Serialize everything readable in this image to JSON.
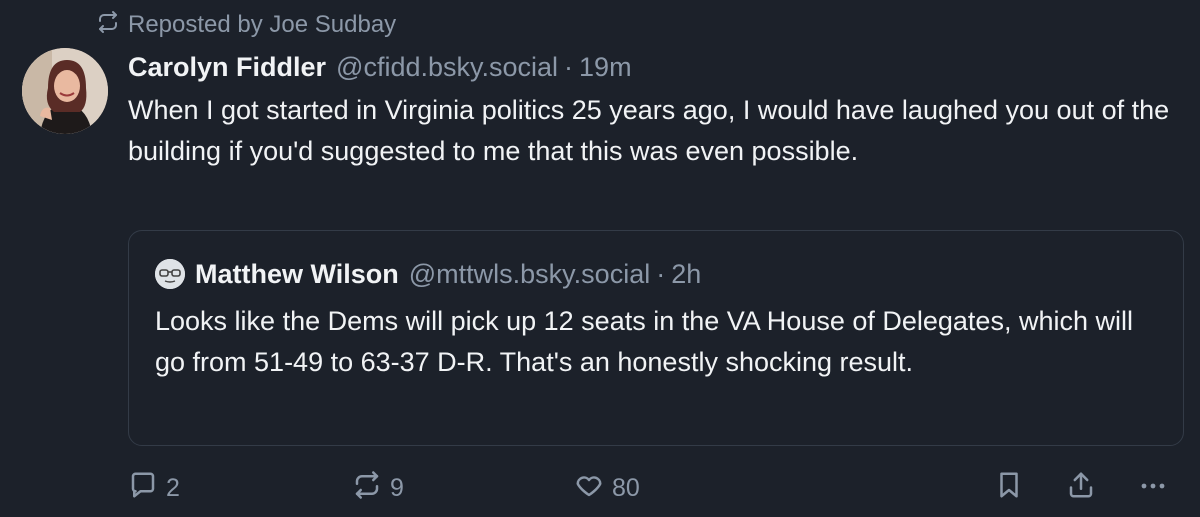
{
  "repost": {
    "icon": "repost-icon",
    "label": "Reposted by Joe Sudbay"
  },
  "post": {
    "author_name": "Carolyn Fiddler",
    "author_handle": "@cfidd.bsky.social",
    "separator": "·",
    "time": "19m",
    "text": "When I got started in Virginia politics 25 years ago, I would have laughed you out of the building if you'd suggested to me that this was even possible."
  },
  "quote": {
    "author_name": "Matthew Wilson",
    "author_handle": "@mttwls.bsky.social",
    "separator": "·",
    "time": "2h",
    "text": "Looks like the Dems will pick up 12 seats in the VA House of Delegates, which will go from 51-49 to 63-37 D-R. That's an honestly shocking result."
  },
  "actions": {
    "reply_count": "2",
    "repost_count": "9",
    "like_count": "80"
  },
  "colors": {
    "background": "#1c212a",
    "text": "#f1f3f5",
    "muted": "#8c98a8",
    "border": "#333b47"
  }
}
